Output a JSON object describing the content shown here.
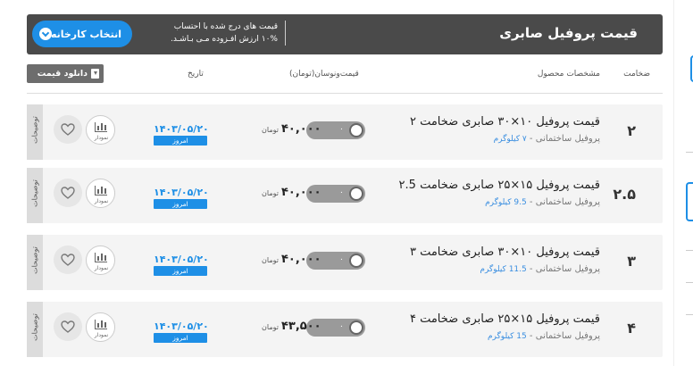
{
  "header": {
    "title": "قیمت پروفیل صابری",
    "note_line1": "قیمت های درج شده با احتساب",
    "note_line2": "۱۰% ارزش افـزوده مـی بـاشـد.",
    "factory_button": "انتخاب کارخانه"
  },
  "columns": {
    "thickness": "ضخامت",
    "specs": "مشخصات محصول",
    "price_change": "قیمت‌ونوسان(تومان)",
    "date": "تاریخ"
  },
  "download_button": "دانلود قیمت",
  "rows": [
    {
      "thickness": "۲",
      "name": "قیمت پروفیل ۱۰×۳۰ صابری ضخامت ۲",
      "category": "پروفیل ساختمانی",
      "weight": "۷ کیلوگرم",
      "toggle_value": "۰",
      "price": "۴۰,۰۰۰",
      "unit": "تومان",
      "date": "۱۴۰۳/۰۵/۲۰",
      "today": "امروز",
      "chart_label": "نمودار",
      "description": "توضیحات"
    },
    {
      "thickness": "۲.۵",
      "name": "قیمت پروفیل ۱۵×۲۵ صابری ضخامت ۲.5",
      "category": "پروفیل ساختمانی",
      "weight": "9.5 کیلوگرم",
      "toggle_value": "۰",
      "price": "۴۰,۰۰۰",
      "unit": "تومان",
      "date": "۱۴۰۳/۰۵/۲۰",
      "today": "امروز",
      "chart_label": "نمودار",
      "description": "توضیحات"
    },
    {
      "thickness": "۳",
      "name": "قیمت پروفیل ۱۰×۳۰ صابری ضخامت ۳",
      "category": "پروفیل ساختمانی",
      "weight": "11.5 کیلوگرم",
      "toggle_value": "۰",
      "price": "۴۰,۰۰۰",
      "unit": "تومان",
      "date": "۱۴۰۳/۰۵/۲۰",
      "today": "امروز",
      "chart_label": "نمودار",
      "description": "توضیحات"
    },
    {
      "thickness": "۴",
      "name": "قیمت پروفیل ۱۵×۲۵ صابری ضخامت ۴",
      "category": "پروفیل ساختمانی",
      "weight": "15 کیلوگرم",
      "toggle_value": "۰",
      "price": "۴۳,۵۰۰",
      "unit": "تومان",
      "date": "۱۴۰۳/۰۵/۲۰",
      "today": "امروز",
      "chart_label": "نمودار",
      "description": "توضیحات"
    }
  ],
  "colors": {
    "header_bg": "#4a4a4a",
    "accent": "#1e8fe6",
    "row_bg": "#f4f4f4",
    "download_bg": "#6d6d6d"
  }
}
